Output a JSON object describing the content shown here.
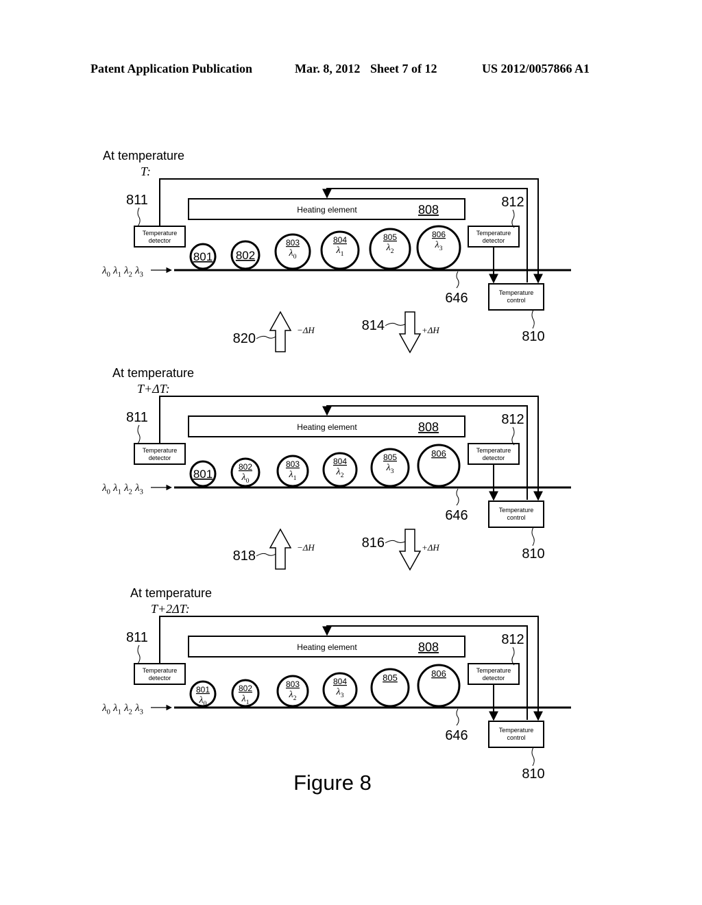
{
  "header": {
    "title": "Patent Application Publication",
    "date": "Mar. 8, 2012",
    "sheet": "Sheet 7 of 12",
    "pub_number": "US 2012/0057866 A1"
  },
  "figure_caption": "Figure 8",
  "panels": [
    {
      "temp_label": "At temperature",
      "temp_value": "T:",
      "detector_left": {
        "ref": "811",
        "line1": "Temperature",
        "line2": "detector"
      },
      "detector_right": {
        "ref": "812",
        "line1": "Temperature",
        "line2": "detector"
      },
      "heater": {
        "label": "Heating element",
        "ref": "808"
      },
      "control": {
        "ref": "810",
        "line1": "Temperature",
        "line2": "control"
      },
      "waveguide_ref": "646",
      "input_wavelengths": [
        "λ0",
        "λ1",
        "λ2",
        "λ3"
      ],
      "rings": [
        {
          "ref": "801",
          "wavelength": ""
        },
        {
          "ref": "802",
          "wavelength": ""
        },
        {
          "ref": "803",
          "wavelength": "λ0"
        },
        {
          "ref": "804",
          "wavelength": "λ1"
        },
        {
          "ref": "805",
          "wavelength": "λ2"
        },
        {
          "ref": "806",
          "wavelength": "λ3"
        }
      ]
    },
    {
      "temp_label": "At temperature",
      "temp_value": "T+ΔT:",
      "detector_left": {
        "ref": "811",
        "line1": "Temperature",
        "line2": "detector"
      },
      "detector_right": {
        "ref": "812",
        "line1": "Temperature",
        "line2": "detector"
      },
      "heater": {
        "label": "Heating element",
        "ref": "808"
      },
      "control": {
        "ref": "810",
        "line1": "Temperature",
        "line2": "control"
      },
      "waveguide_ref": "646",
      "input_wavelengths": [
        "λ0",
        "λ1",
        "λ2",
        "λ3"
      ],
      "rings": [
        {
          "ref": "801",
          "wavelength": ""
        },
        {
          "ref": "802",
          "wavelength": "λ0"
        },
        {
          "ref": "803",
          "wavelength": "λ1"
        },
        {
          "ref": "804",
          "wavelength": "λ2"
        },
        {
          "ref": "805",
          "wavelength": "λ3"
        },
        {
          "ref": "806",
          "wavelength": ""
        }
      ]
    },
    {
      "temp_label": "At temperature",
      "temp_value": "T+2ΔT:",
      "detector_left": {
        "ref": "811",
        "line1": "Temperature",
        "line2": "detector"
      },
      "detector_right": {
        "ref": "812",
        "line1": "Temperature",
        "line2": "detector"
      },
      "heater": {
        "label": "Heating element",
        "ref": "808"
      },
      "control": {
        "ref": "810",
        "line1": "Temperature",
        "line2": "control"
      },
      "waveguide_ref": "646",
      "input_wavelengths": [
        "λ0",
        "λ1",
        "λ2",
        "λ3"
      ],
      "rings": [
        {
          "ref": "801",
          "wavelength": "λ0"
        },
        {
          "ref": "802",
          "wavelength": "λ1"
        },
        {
          "ref": "803",
          "wavelength": "λ2"
        },
        {
          "ref": "804",
          "wavelength": "λ3"
        },
        {
          "ref": "805",
          "wavelength": ""
        },
        {
          "ref": "806",
          "wavelength": ""
        }
      ]
    }
  ],
  "transitions": [
    {
      "up": {
        "ref": "820",
        "label": "−ΔH"
      },
      "down": {
        "ref": "814",
        "label": "+ΔH"
      }
    },
    {
      "up": {
        "ref": "818",
        "label": "−ΔH"
      },
      "down": {
        "ref": "816",
        "label": "+ΔH"
      }
    }
  ]
}
